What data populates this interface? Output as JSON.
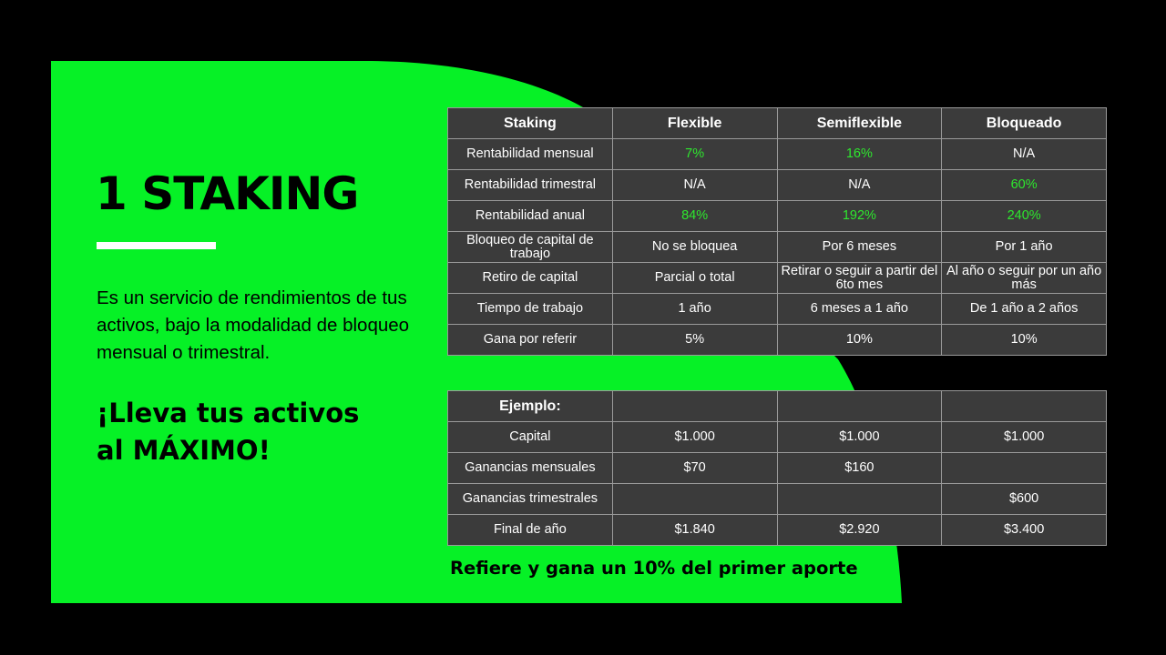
{
  "colors": {
    "green": "#06f126",
    "background": "#000000",
    "table_bg": "#3b3b3b",
    "highlight": "#2ee82e"
  },
  "title": "1 STAKING",
  "description": "Es un servicio de rendimientos de tus activos, bajo la modalidad de bloqueo mensual o trimestral.",
  "cta": {
    "line1": "¡Lleva tus activos",
    "line2": "al MÁXIMO!"
  },
  "main_table": {
    "headers": [
      "Staking",
      "Flexible",
      "Semiflexible",
      "Bloqueado"
    ],
    "rows": [
      [
        "Rentabilidad mensual",
        "7%",
        "16%",
        "N/A"
      ],
      [
        "Rentabilidad trimestral",
        "N/A",
        "N/A",
        "60%"
      ],
      [
        "Rentabilidad anual",
        "84%",
        "192%",
        "240%"
      ],
      [
        "Bloqueo de capital de trabajo",
        "No se bloquea",
        "Por 6 meses",
        "Por 1 año"
      ],
      [
        "Retiro de capital",
        "Parcial o total",
        "Retirar o seguir a partir del 6to mes",
        "Al año o seguir por un año más"
      ],
      [
        "Tiempo de trabajo",
        "1 año",
        "6 meses a 1 año",
        "De 1 año a 2 años"
      ],
      [
        "Gana por referir",
        "5%",
        "10%",
        "10%"
      ]
    ]
  },
  "example_table": {
    "headers": [
      "Ejemplo:",
      "",
      "",
      ""
    ],
    "rows": [
      [
        "Capital",
        "$1.000",
        "$1.000",
        "$1.000"
      ],
      [
        "Ganancias mensuales",
        "$70",
        "$160",
        ""
      ],
      [
        "Ganancias trimestrales",
        "",
        "",
        "$600"
      ],
      [
        "Final de año",
        "$1.840",
        "$2.920",
        "$3.400"
      ]
    ]
  },
  "footer": "Refiere y gana un 10% del primer aporte"
}
